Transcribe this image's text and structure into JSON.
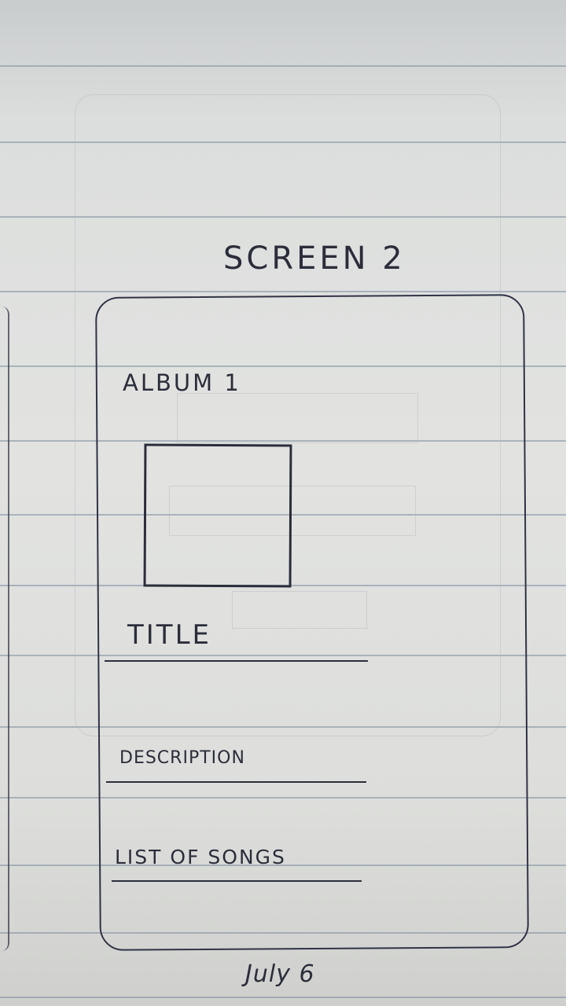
{
  "header": {
    "screen_title": "SCREEN 2"
  },
  "album": {
    "label": "ALBUM 1"
  },
  "fields": {
    "title": "TITLE",
    "description": "DESCRIPTION",
    "songs": "LIST OF SONGS"
  },
  "footer": {
    "date": "July 6"
  },
  "colors": {
    "paper": "#e0e1df",
    "rule": "#7d8a9b",
    "ink": "#2b2d3a"
  }
}
